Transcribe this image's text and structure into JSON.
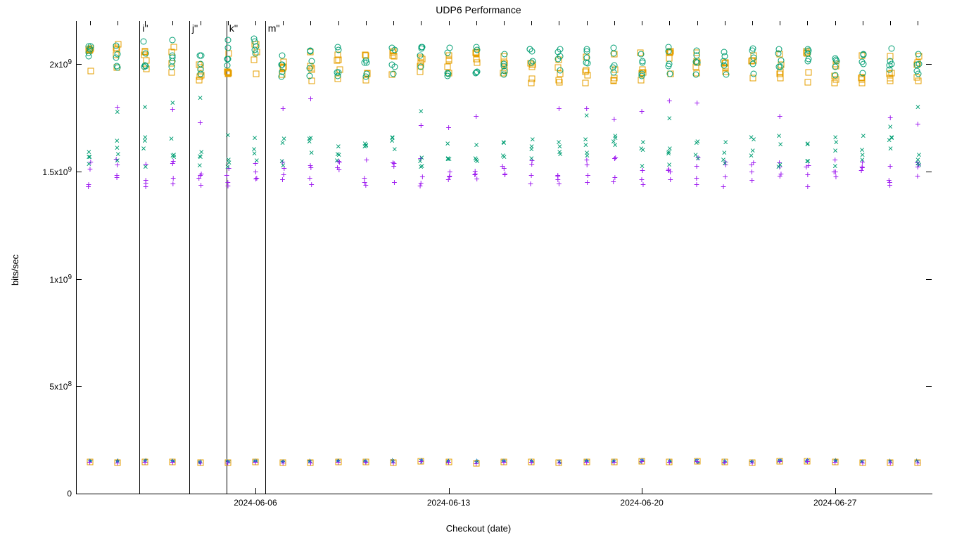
{
  "chart_data": {
    "type": "scatter",
    "title": "UDP6 Performance",
    "xlabel": "Checkout (date)",
    "ylabel": "bits/sec",
    "ylim": [
      0,
      2200000000
    ],
    "xlim": [
      "2024-05-31",
      "2024-07-01"
    ],
    "yticks": [
      {
        "v": 0,
        "label": "0"
      },
      {
        "v": 500000000,
        "label_html": "5x10<sup>8</sup>"
      },
      {
        "v": 1000000000,
        "label_html": "1x10<sup>9</sup>"
      },
      {
        "v": 1500000000,
        "label_html": "1.5x10<sup>9</sup>"
      },
      {
        "v": 2000000000,
        "label_html": "2x10<sup>9</sup>"
      }
    ],
    "xticks": [
      {
        "day": 6,
        "label": "2024-06-06"
      },
      {
        "day": 13,
        "label": "2024-06-13"
      },
      {
        "day": 20,
        "label": "2024-06-20"
      },
      {
        "day": 27,
        "label": "2024-06-27"
      }
    ],
    "vlines": [
      {
        "day": 1.8,
        "label": "i''"
      },
      {
        "day": 3.6,
        "label": "j''"
      },
      {
        "day": 4.95,
        "label": "k''"
      },
      {
        "day": 6.35,
        "label": "m''"
      }
    ],
    "days": [
      0,
      1,
      2,
      3,
      4,
      5,
      6,
      7,
      8,
      9,
      10,
      11,
      12,
      13,
      14,
      15,
      16,
      17,
      18,
      19,
      20,
      21,
      22,
      23,
      24,
      25,
      26,
      27,
      28,
      29,
      30
    ],
    "series": [
      {
        "name": "plus",
        "marker": "plus",
        "band_low": 1430000000,
        "band_high": 1570000000,
        "outlier_low": 1700000000,
        "outlier_high": 1850000000
      },
      {
        "name": "x",
        "marker": "x",
        "band_low": 1520000000,
        "band_high": 1670000000,
        "outlier_low": 1700000000,
        "outlier_high": 1850000000
      },
      {
        "name": "square",
        "marker": "sq",
        "band_low": 1950000000,
        "band_high": 2100000000
      },
      {
        "name": "circle",
        "marker": "circ",
        "band_low": 1980000000,
        "band_high": 2120000000
      },
      {
        "name": "star-low",
        "marker": "star",
        "band_low": 138000000,
        "band_high": 150000000
      }
    ]
  }
}
